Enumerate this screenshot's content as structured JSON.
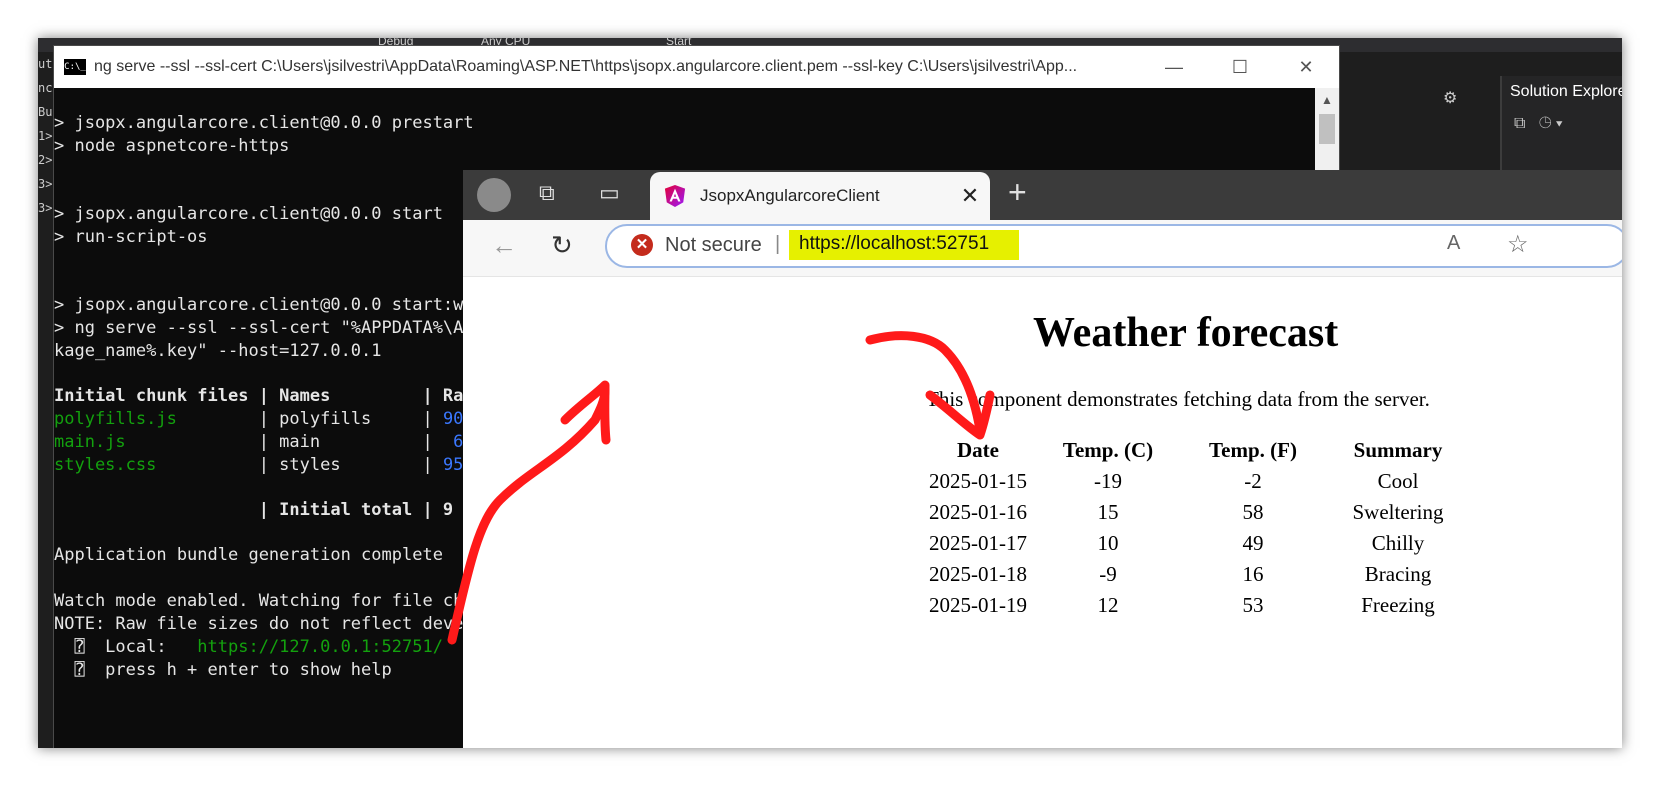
{
  "terminal": {
    "title": "ng serve --ssl --ssl-cert C:\\Users\\jsilvestri\\AppData\\Roaming\\ASP.NET\\https\\jsopx.angularcore.client.pem --ssl-key C:\\Users\\jsilvestri\\App...",
    "minimize": "—",
    "maximize": "☐",
    "close": "✕",
    "lines": {
      "l1": "> jsopx.angularcore.client@0.0.0 prestart",
      "l2": "> node aspnetcore-https",
      "l3": "> jsopx.angularcore.client@0.0.0 start",
      "l4": "> run-script-os",
      "l5": "> jsopx.angularcore.client@0.0.0 start:w",
      "l6": "> ng serve --ssl --ssl-cert \"%APPDATA%\\A",
      "l7": "kage_name%.key\" --host=127.0.0.1",
      "l8": "Initial chunk files | Names         | Ra",
      "l9a": "polyfills.js",
      "l9b": "        | polyfills     | ",
      "l9c": "90",
      "l10a": "main.js",
      "l10b": "             | main          |  ",
      "l10c": "6",
      "l11a": "styles.css",
      "l11b": "          | styles        | ",
      "l11c": "95",
      "l12": "                    | Initial total | 9",
      "l13": "Application bundle generation complete",
      "l14": "Watch mode enabled. Watching for file ch",
      "l15": "NOTE: Raw file sizes do not reflect deve",
      "l16a": "  ⍰  Local:   ",
      "l16b": "https://127.0.0.1:52751/",
      "l17": "  ⍰  press h + enter to show help"
    }
  },
  "vs": {
    "toolbar_debug": "Debug",
    "toolbar_cpu": "Any CPU",
    "toolbar_start": "Start",
    "solution_explorer": "Solution Explorer"
  },
  "browser": {
    "tab_title": "JsopxAngularcoreClient",
    "tab_close": "✕",
    "new_tab": "+",
    "back": "←",
    "refresh": "↻",
    "not_secure": "Not secure",
    "url": "https://localhost:52751",
    "read_aloud": "A",
    "favorite": "☆"
  },
  "page": {
    "title": "Weather forecast",
    "intro": "This component demonstrates fetching data from the server.",
    "headers": [
      "Date",
      "Temp. (C)",
      "Temp. (F)",
      "Summary"
    ],
    "rows": [
      [
        "2025-01-15",
        "-19",
        "-2",
        "Cool"
      ],
      [
        "2025-01-16",
        "15",
        "58",
        "Sweltering"
      ],
      [
        "2025-01-17",
        "10",
        "49",
        "Chilly"
      ],
      [
        "2025-01-18",
        "-9",
        "16",
        "Bracing"
      ],
      [
        "2025-01-19",
        "12",
        "53",
        "Freezing"
      ]
    ]
  },
  "colors": {
    "annotation_red": "#ff1a1a",
    "url_highlight": "#e6f000",
    "terminal_green": "#13a10e",
    "terminal_blue": "#3b78ff"
  }
}
